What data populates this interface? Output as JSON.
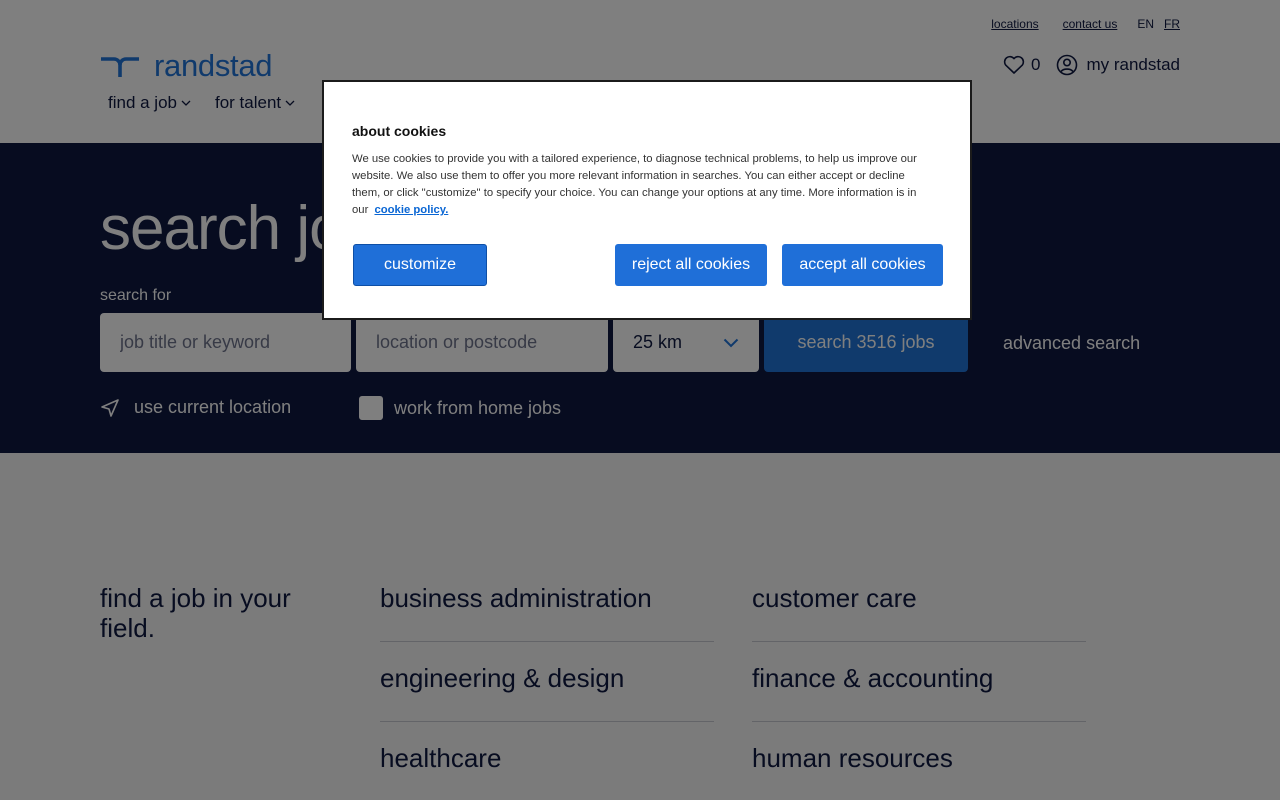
{
  "header": {
    "utility_links": [
      "locations",
      "contact us"
    ],
    "languages": [
      "EN",
      "FR"
    ],
    "logo_text": "randstad",
    "nav": [
      "find a job",
      "for talent"
    ],
    "favorites_count": "0",
    "account_label": "my randstad"
  },
  "hero": {
    "title": "search jobs",
    "search_label": "search for",
    "keyword_placeholder": "job title or keyword",
    "location_placeholder": "location or postcode",
    "radius_value": "25 km",
    "search_button": "search 3516 jobs",
    "advanced_search": "advanced search",
    "use_location": "use current location",
    "wfh_label": "work from home jobs"
  },
  "content": {
    "section_title": "find a job in your field.",
    "categories": [
      "business administration",
      "customer care",
      "engineering & design",
      "finance & accounting",
      "healthcare",
      "human resources"
    ]
  },
  "cookie_dialog": {
    "title": "about cookies",
    "body": "We use cookies to provide you with a tailored experience, to diagnose technical problems, to help us improve our website. We also use them to offer you more relevant information in searches. You can either accept or decline them, or click \"customize\" to specify your choice. You can change your options at any time. More information is in our",
    "policy_link": "cookie policy.",
    "customize_label": "customize",
    "reject_label": "reject all cookies",
    "accept_label": "accept all cookies"
  },
  "colors": {
    "brand_blue": "#2175d9",
    "navy": "#0f1941",
    "dialog_button": "#1f6fd8"
  }
}
